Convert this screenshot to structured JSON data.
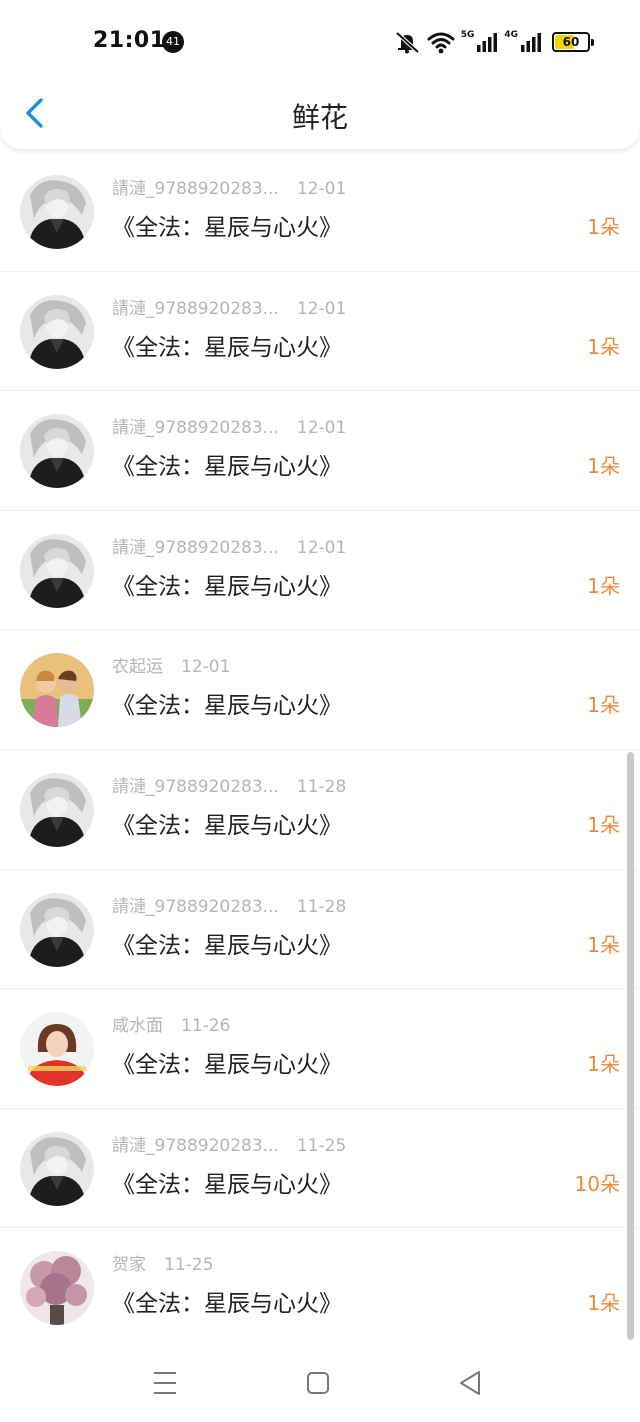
{
  "status_bar": {
    "time": "21:01",
    "notification_count": "41",
    "net_5g": "5G",
    "net_4g": "4G",
    "battery": "60",
    "battery_level": 0.6
  },
  "header": {
    "title": "鲜花",
    "back_icon": "chevron-left-icon"
  },
  "colors": {
    "accent_blue": "#1e8fe0",
    "count_orange": "#ee8a3c",
    "meta_gray": "#b5b5b5"
  },
  "list": [
    {
      "user": "請漣_9788920283...",
      "date": "12-01",
      "book": "《全法：星辰与心火》",
      "count": "1朵",
      "avatar": "bw-portrait-avatar"
    },
    {
      "user": "請漣_9788920283...",
      "date": "12-01",
      "book": "《全法：星辰与心火》",
      "count": "1朵",
      "avatar": "bw-portrait-avatar"
    },
    {
      "user": "請漣_9788920283...",
      "date": "12-01",
      "book": "《全法：星辰与心火》",
      "count": "1朵",
      "avatar": "bw-portrait-avatar"
    },
    {
      "user": "請漣_9788920283...",
      "date": "12-01",
      "book": "《全法：星辰与心火》",
      "count": "1朵",
      "avatar": "bw-portrait-avatar"
    },
    {
      "user": "农起运",
      "date": "12-01",
      "book": "《全法：星辰与心火》",
      "count": "1朵",
      "avatar": "couple-photo-avatar"
    },
    {
      "user": "請漣_9788920283...",
      "date": "11-28",
      "book": "《全法：星辰与心火》",
      "count": "1朵",
      "avatar": "bw-portrait-avatar"
    },
    {
      "user": "請漣_9788920283...",
      "date": "11-28",
      "book": "《全法：星辰与心火》",
      "count": "1朵",
      "avatar": "bw-portrait-avatar"
    },
    {
      "user": "咸水面",
      "date": "11-26",
      "book": "《全法：星辰与心火》",
      "count": "1朵",
      "avatar": "girl-red-shirt-avatar"
    },
    {
      "user": "請漣_9788920283...",
      "date": "11-25",
      "book": "《全法：星辰与心火》",
      "count": "10朵",
      "avatar": "bw-portrait-avatar"
    },
    {
      "user": "贺家",
      "date": "11-25",
      "book": "《全法：星辰与心火》",
      "count": "1朵",
      "avatar": "flower-bouquet-avatar"
    }
  ],
  "nav_bar": {
    "menu_icon": "menu-icon",
    "home_icon": "home-square-icon",
    "back_icon": "back-triangle-icon"
  }
}
